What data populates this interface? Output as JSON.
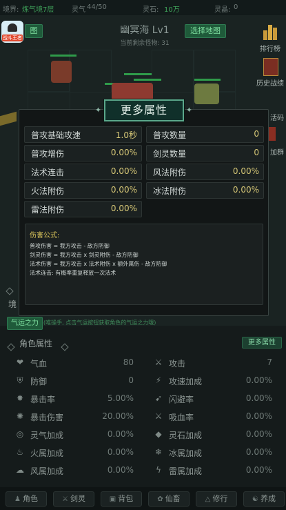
{
  "status_bar": {
    "realm_label": "境界:",
    "realm_value": "炼气境7层",
    "qi_label": "灵气",
    "qi_value": "44/50",
    "stone_label": "灵石:",
    "stone_value": "10万",
    "crystal_label": "灵晶:",
    "crystal_value": "0"
  },
  "app_icon": {
    "label": "战斗王者"
  },
  "map": {
    "title": "幽冥海 Lv1",
    "remaining": "当前剩余怪物: 31",
    "select_btn": "选择地图"
  },
  "left_btn": "图",
  "side_menu": [
    "排行榜",
    "历史战绩",
    "活码",
    "加群"
  ],
  "modal": {
    "title": "更多属性",
    "stats": [
      {
        "key": "普攻基础攻速",
        "value": "1.0秒"
      },
      {
        "key": "普攻数量",
        "value": "0"
      },
      {
        "key": "普攻增伤",
        "value": "0.00%"
      },
      {
        "key": "剑灵数量",
        "value": "0"
      },
      {
        "key": "法术连击",
        "value": "0.00%"
      },
      {
        "key": "风法附伤",
        "value": "0.00%"
      },
      {
        "key": "火法附伤",
        "value": "0.00%"
      },
      {
        "key": "冰法附伤",
        "value": "0.00%"
      },
      {
        "key": "雷法附伤",
        "value": "0.00%"
      }
    ],
    "formula_title": "伤害公式:",
    "formula_lines": [
      "普攻伤害 = 我方攻击 - 敌方防御",
      "剑灵伤害 = 我方攻击 x 剑灵附伤 - 敌方防御",
      "法术伤害 = 我方攻击 x 法术附伤 x 额外属伤 - 敌方防御",
      "法术连击: 有概率重复释放一次法术"
    ]
  },
  "lower": {
    "realm_label": "境",
    "luck_btn": "气运之力",
    "luck_hint": "(唯操手, 点击气运按钮获取角色的气运之力哦)",
    "section_title": "角色属性",
    "more_btn": "更多属性",
    "attributes": [
      {
        "icon": "blood-icon",
        "glyph": "❤",
        "key": "气血",
        "value": "80"
      },
      {
        "icon": "sword-icon",
        "glyph": "⚔",
        "key": "攻击",
        "value": "7"
      },
      {
        "icon": "armor-icon",
        "glyph": "⛨",
        "key": "防御",
        "value": "0"
      },
      {
        "icon": "speed-icon",
        "glyph": "⚡",
        "key": "攻速加成",
        "value": "0.00%"
      },
      {
        "icon": "crit-icon",
        "glyph": "✸",
        "key": "暴击率",
        "value": "5.00%"
      },
      {
        "icon": "dodge-icon",
        "glyph": "➹",
        "key": "闪避率",
        "value": "0.00%"
      },
      {
        "icon": "crit-dmg-icon",
        "glyph": "✺",
        "key": "暴击伤害",
        "value": "20.00%"
      },
      {
        "icon": "lifesteal-icon",
        "glyph": "⚔",
        "key": "吸血率",
        "value": "0.00%"
      },
      {
        "icon": "spirit-icon",
        "glyph": "◎",
        "key": "灵气加成",
        "value": "0.00%"
      },
      {
        "icon": "stone-icon",
        "glyph": "◆",
        "key": "灵石加成",
        "value": "0.00%"
      },
      {
        "icon": "fire-icon",
        "glyph": "♨",
        "key": "火属加成",
        "value": "0.00%"
      },
      {
        "icon": "ice-icon",
        "glyph": "❄",
        "key": "冰属加成",
        "value": "0.00%"
      },
      {
        "icon": "wind-icon",
        "glyph": "☁",
        "key": "风属加成",
        "value": "0.00%"
      },
      {
        "icon": "thunder-icon",
        "glyph": "ϟ",
        "key": "雷属加成",
        "value": "0.00%"
      }
    ]
  },
  "nav": [
    {
      "icon": "character-icon",
      "glyph": "♟",
      "label": "角色"
    },
    {
      "icon": "sword-spirit-icon",
      "glyph": "⚔",
      "label": "剑灵"
    },
    {
      "icon": "bag-icon",
      "glyph": "▣",
      "label": "背包"
    },
    {
      "icon": "pet-icon",
      "glyph": "✿",
      "label": "仙畜"
    },
    {
      "icon": "cultivate-icon",
      "glyph": "△",
      "label": "修行"
    },
    {
      "icon": "cultivate2-icon",
      "glyph": "☯",
      "label": "养成"
    }
  ]
}
